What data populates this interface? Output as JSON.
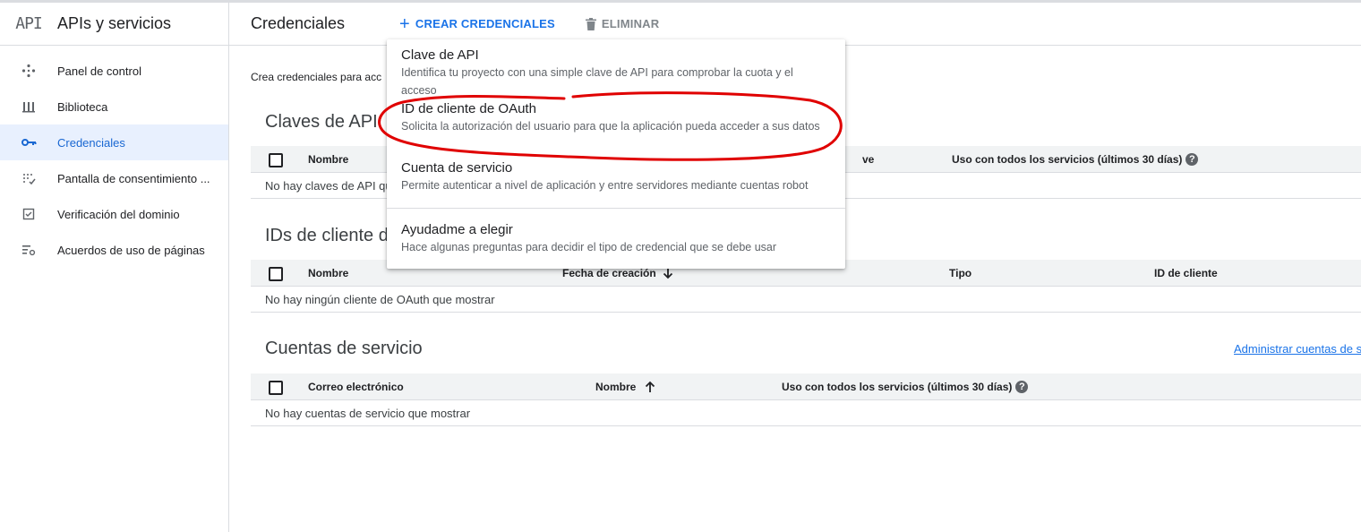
{
  "sidebar": {
    "logo": "API",
    "title": "APIs y servicios",
    "items": [
      {
        "label": "Panel de control",
        "icon": "dashboard-icon"
      },
      {
        "label": "Biblioteca",
        "icon": "library-icon"
      },
      {
        "label": "Credenciales",
        "icon": "key-icon",
        "active": true
      },
      {
        "label": "Pantalla de consentimiento ...",
        "icon": "consent-screen-icon"
      },
      {
        "label": "Verificación del dominio",
        "icon": "domain-check-icon"
      },
      {
        "label": "Acuerdos de uso de páginas",
        "icon": "settings-list-icon"
      }
    ]
  },
  "toolbar": {
    "title": "Credenciales",
    "create_label": "CREAR CREDENCIALES",
    "delete_label": "ELIMINAR"
  },
  "intro": "Crea credenciales para acc",
  "api_keys": {
    "title": "Claves de API",
    "columns": [
      "Nombre",
      "ve",
      "Uso con todos los servicios (últimos 30 días)"
    ],
    "empty": "No hay claves de API qu"
  },
  "oauth": {
    "title": "IDs de cliente d",
    "columns": [
      "Nombre",
      "Fecha de creación",
      "Tipo",
      "ID de cliente"
    ],
    "empty": "No hay ningún cliente de OAuth que mostrar"
  },
  "service_accounts": {
    "title": "Cuentas de servicio",
    "manage_link": "Administrar cuentas de s",
    "columns": [
      "Correo electrónico",
      "Nombre",
      "Uso con todos los servicios (últimos 30 días)"
    ],
    "empty": "No hay cuentas de servicio que mostrar"
  },
  "menu": {
    "items": [
      {
        "title": "Clave de API",
        "desc": "Identifica tu proyecto con una simple clave de API para comprobar la cuota y el acceso"
      },
      {
        "title": "ID de cliente de OAuth",
        "desc": "Solicita la autorización del usuario para que la aplicación pueda acceder a sus datos"
      },
      {
        "title": "Cuenta de servicio",
        "desc": "Permite autenticar a nivel de aplicación y entre servidores mediante cuentas robot"
      },
      {
        "title": "Ayudadme a elegir",
        "desc": "Hace algunas preguntas para decidir el tipo de credencial que se debe usar"
      }
    ]
  },
  "colors": {
    "accent": "#1a73e8",
    "active_bg": "#e8f0fe",
    "annotation": "#e00000"
  }
}
